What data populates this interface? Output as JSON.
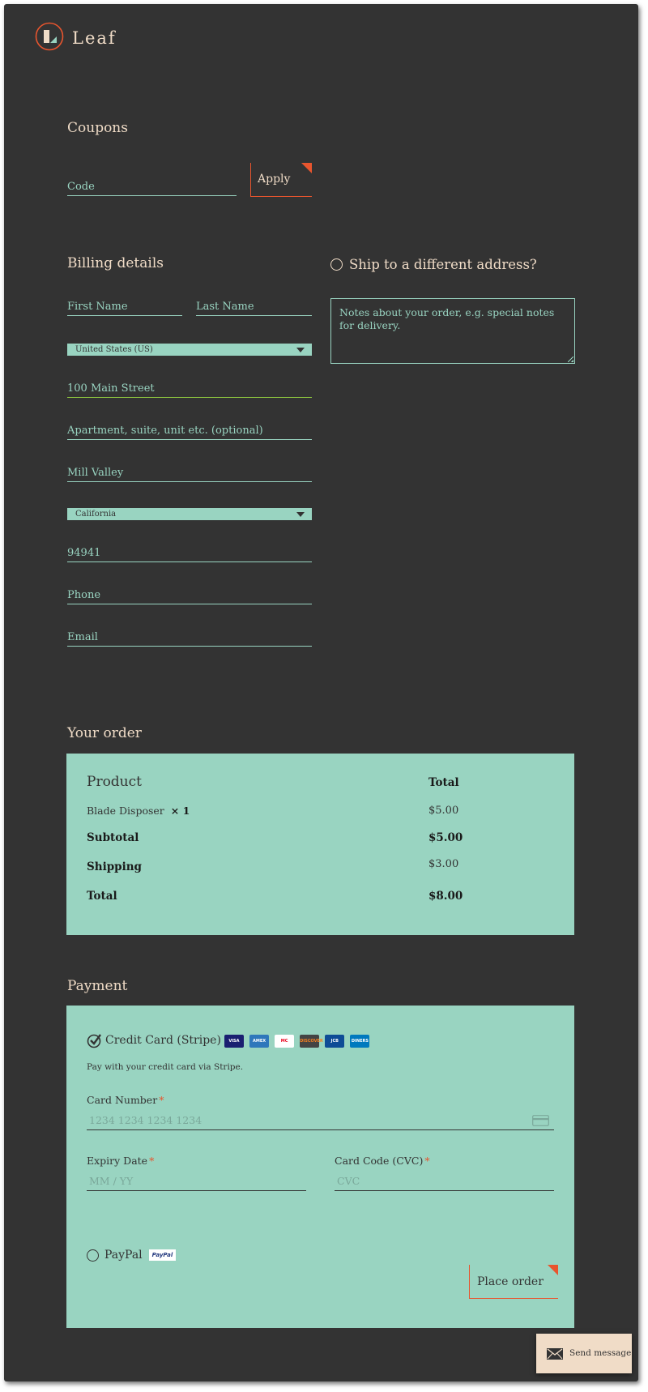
{
  "brand": {
    "name": "Leaf"
  },
  "coupons": {
    "title": "Coupons",
    "code_placeholder": "Code",
    "apply_label": "Apply"
  },
  "billing": {
    "title": "Billing details",
    "first_name_placeholder": "First Name",
    "last_name_placeholder": "Last Name",
    "country_value": "United States (US)",
    "address_value": "100 Main Street",
    "address2_placeholder": "Apartment, suite, unit etc. (optional)",
    "city_value": "Mill Valley",
    "state_value": "California",
    "zip_value": "94941",
    "phone_placeholder": "Phone",
    "email_placeholder": "Email"
  },
  "shipping": {
    "ship_different_label": "Ship to a different address?",
    "notes_placeholder": "Notes about your order, e.g. special notes for delivery."
  },
  "order": {
    "title": "Your order",
    "col_product": "Product",
    "col_total": "Total",
    "item_name": "Blade Disposer",
    "item_qty": "× 1",
    "item_total": "$5.00",
    "subtotal_label": "Subtotal",
    "subtotal_value": "$5.00",
    "shipping_label": "Shipping",
    "shipping_value": "$3.00",
    "total_label": "Total",
    "total_value": "$8.00"
  },
  "payment": {
    "title": "Payment",
    "stripe_label": "Credit Card (Stripe)",
    "card_brands": [
      "VISA",
      "AMEX",
      "MC",
      "DISCOVER",
      "JCB",
      "DINERS"
    ],
    "stripe_desc": "Pay with your credit card via Stripe.",
    "card_number_label": "Card Number",
    "card_number_placeholder": "1234 1234 1234 1234",
    "expiry_label": "Expiry Date",
    "expiry_placeholder": "MM / YY",
    "cvc_label": "Card Code (CVC)",
    "cvc_placeholder": "CVC",
    "required_mark": "*",
    "paypal_label": "PayPal",
    "paypal_badge": "PayPal",
    "place_order_label": "Place order"
  },
  "chat": {
    "send_label": "Send message"
  },
  "colors": {
    "background": "#333333",
    "accent_mint": "#99d4c1",
    "accent_orange": "#e8552e",
    "cream": "#f0dcc7"
  }
}
